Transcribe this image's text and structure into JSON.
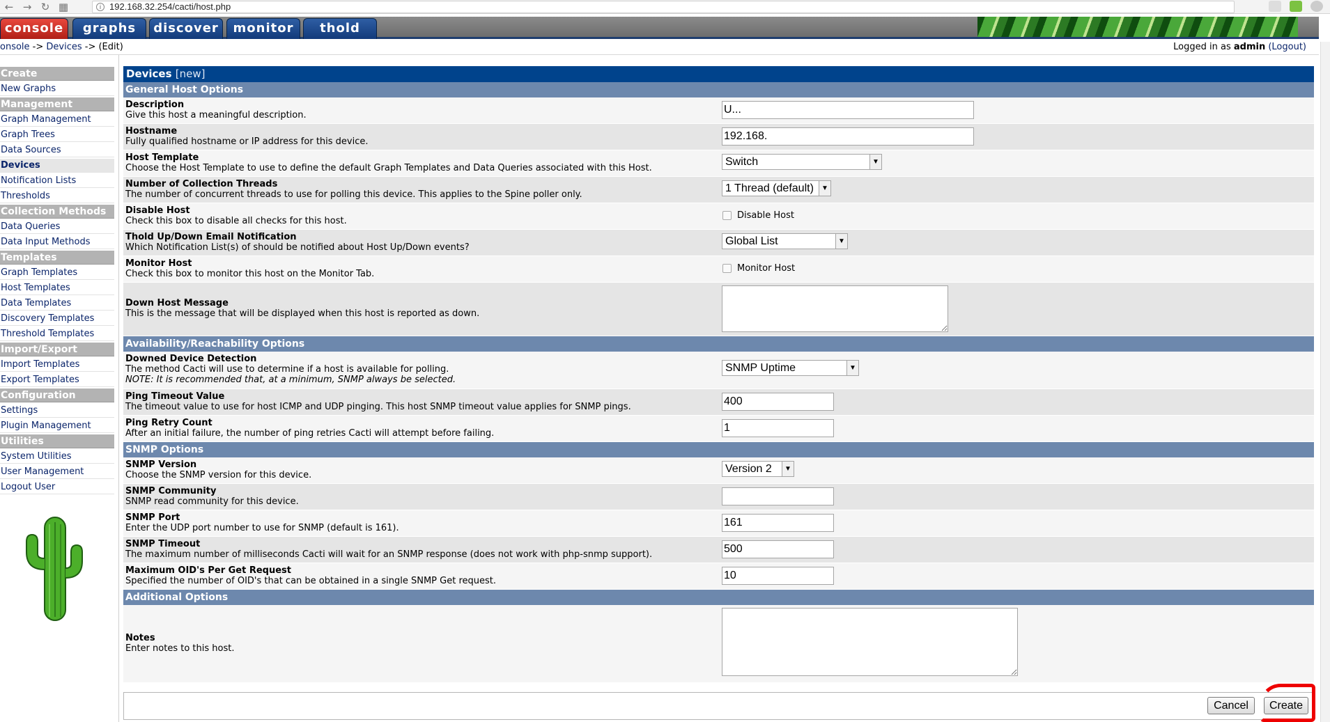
{
  "browser": {
    "url": "192.168.32.254/cacti/host.php"
  },
  "tabs": [
    {
      "label": "console",
      "active": true
    },
    {
      "label": "graphs",
      "active": false
    },
    {
      "label": "discover",
      "active": false
    },
    {
      "label": "monitor",
      "active": false
    },
    {
      "label": "thold",
      "active": false
    }
  ],
  "breadcrumb": {
    "console": "onsole",
    "sep1": " -> ",
    "devices": "Devices",
    "sep2": " -> ",
    "current": "(Edit)"
  },
  "login": {
    "prefix": "Logged in as ",
    "user": "admin",
    "logout": "(Logout)"
  },
  "sidebar": {
    "create": "Create",
    "new_graphs": "New Graphs",
    "management": "Management",
    "graph_management": "Graph Management",
    "graph_trees": "Graph Trees",
    "data_sources": "Data Sources",
    "devices": "Devices",
    "notification_lists": "Notification Lists",
    "thresholds": "Thresholds",
    "collection_methods": "Collection Methods",
    "data_queries": "Data Queries",
    "data_input_methods": "Data Input Methods",
    "templates": "Templates",
    "graph_templates": "Graph Templates",
    "host_templates": "Host Templates",
    "data_templates": "Data Templates",
    "discovery_templates": "Discovery Templates",
    "threshold_templates": "Threshold Templates",
    "import_export": "Import/Export",
    "import_templates": "Import Templates",
    "export_templates": "Export Templates",
    "configuration": "Configuration",
    "settings": "Settings",
    "plugin_management": "Plugin Management",
    "utilities": "Utilities",
    "system_utilities": "System Utilities",
    "user_management": "User Management",
    "logout_user": "Logout User"
  },
  "form": {
    "title": "Devices",
    "title_suffix": "[new]",
    "sections": {
      "general": "General Host Options",
      "availability": "Availability/Reachability Options",
      "snmp": "SNMP Options",
      "additional": "Additional Options"
    },
    "description": {
      "label": "Description",
      "help": "Give this host a meaningful description.",
      "value": "U..."
    },
    "hostname": {
      "label": "Hostname",
      "help": "Fully qualified hostname or IP address for this device.",
      "value": "192.168."
    },
    "host_template": {
      "label": "Host Template",
      "help": "Choose the Host Template to use to define the default Graph Templates and Data Queries associated with this Host.",
      "value": "Switch"
    },
    "threads": {
      "label": "Number of Collection Threads",
      "help": "The number of concurrent threads to use for polling this device. This applies to the Spine poller only.",
      "value": "1 Thread (default)"
    },
    "disable_host": {
      "label": "Disable Host",
      "help": "Check this box to disable all checks for this host.",
      "checkbox_label": "Disable Host",
      "checked": false
    },
    "thold_notify": {
      "label": "Thold Up/Down Email Notification",
      "help": "Which Notification List(s) of should be notified about Host Up/Down events?",
      "value": "Global List"
    },
    "monitor_host": {
      "label": "Monitor Host",
      "help": "Check this box to monitor this host on the Monitor Tab.",
      "checkbox_label": "Monitor Host",
      "checked": false
    },
    "down_message": {
      "label": "Down Host Message",
      "help": "This is the message that will be displayed when this host is reported as down.",
      "value": ""
    },
    "downed_detection": {
      "label": "Downed Device Detection",
      "help": "The method Cacti will use to determine if a host is available for polling.",
      "note": "NOTE: It is recommended that, at a minimum, SNMP always be selected.",
      "value": "SNMP Uptime"
    },
    "ping_timeout": {
      "label": "Ping Timeout Value",
      "help": "The timeout value to use for host ICMP and UDP pinging. This host SNMP timeout value applies for SNMP pings.",
      "value": "400"
    },
    "ping_retry": {
      "label": "Ping Retry Count",
      "help": "After an initial failure, the number of ping retries Cacti will attempt before failing.",
      "value": "1"
    },
    "snmp_version": {
      "label": "SNMP Version",
      "help": "Choose the SNMP version for this device.",
      "value": "Version 2"
    },
    "snmp_community": {
      "label": "SNMP Community",
      "help": "SNMP read community for this device.",
      "value": ""
    },
    "snmp_port": {
      "label": "SNMP Port",
      "help": "Enter the UDP port number to use for SNMP (default is 161).",
      "value": "161"
    },
    "snmp_timeout": {
      "label": "SNMP Timeout",
      "help": "The maximum number of milliseconds Cacti will wait for an SNMP response (does not work with php-snmp support).",
      "value": "500"
    },
    "max_oids": {
      "label": "Maximum OID's Per Get Request",
      "help": "Specified the number of OID's that can be obtained in a single SNMP Get request.",
      "value": "10"
    },
    "notes": {
      "label": "Notes",
      "help": "Enter notes to this host.",
      "value": ""
    }
  },
  "buttons": {
    "cancel": "Cancel",
    "create": "Create"
  }
}
